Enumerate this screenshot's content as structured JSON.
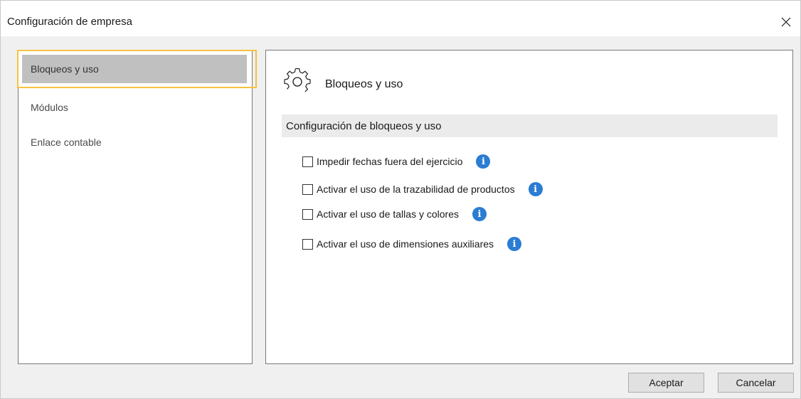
{
  "window": {
    "title": "Configuración de empresa"
  },
  "nav": {
    "items": [
      {
        "label": "Bloqueos y uso",
        "selected": true
      },
      {
        "label": "Módulos",
        "selected": false
      },
      {
        "label": "Enlace contable",
        "selected": false
      }
    ]
  },
  "content": {
    "section_title": "Bloqueos y uso",
    "group_title": "Configuración de bloqueos y uso",
    "options": [
      {
        "label": "Impedir fechas fuera del ejercicio",
        "checked": false
      },
      {
        "label": "Activar el uso de la trazabilidad de productos",
        "checked": false
      },
      {
        "label": "Activar el uso de tallas y colores",
        "checked": false
      },
      {
        "label": "Activar el uso de dimensiones auxiliares",
        "checked": false
      }
    ],
    "info_glyph": "i"
  },
  "footer": {
    "accept_label": "Aceptar",
    "cancel_label": "Cancelar"
  },
  "colors": {
    "selection_border": "#f5c242",
    "info_blue": "#2b7cd3",
    "selected_bg": "#c0c0c0"
  }
}
